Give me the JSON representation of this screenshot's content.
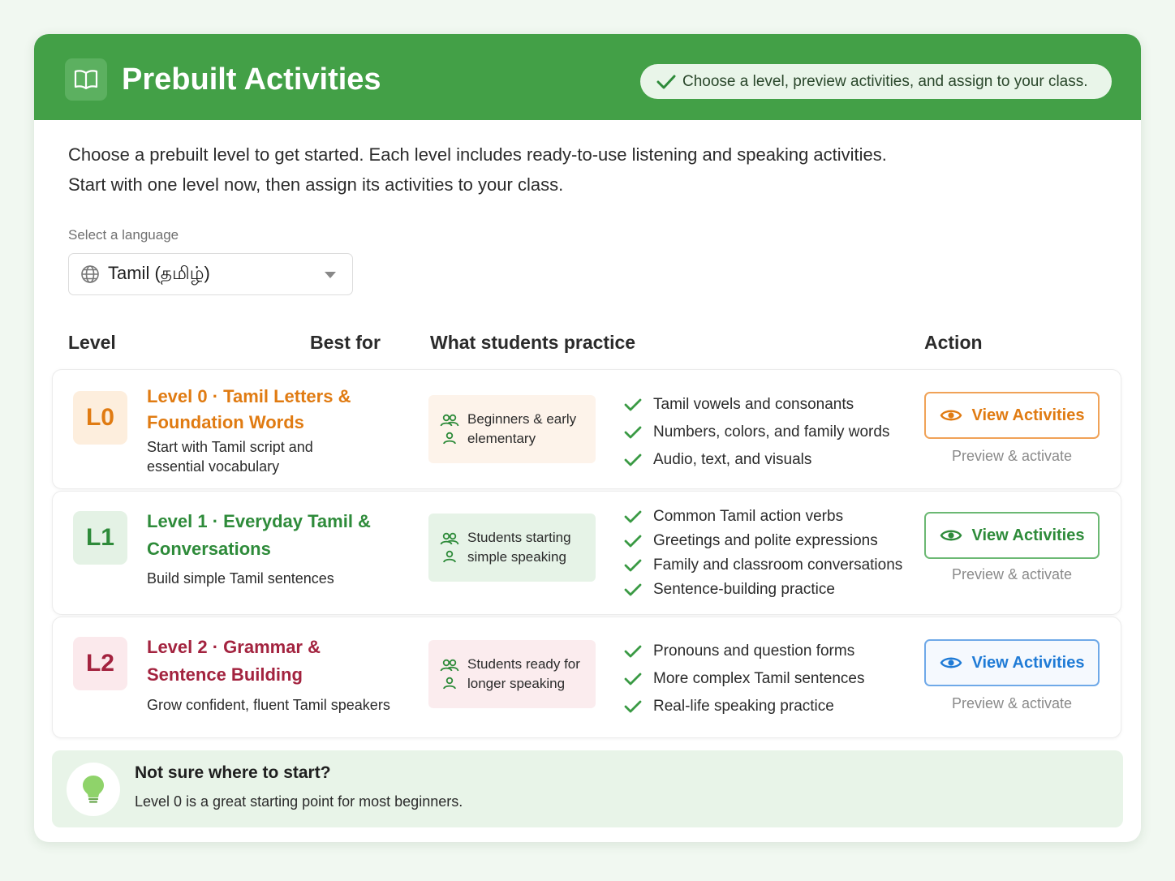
{
  "header": {
    "title": "Prebuilt Activities",
    "hint": "Choose a level, preview activities, and assign to your class."
  },
  "intro": {
    "line1": "Choose a prebuilt level to get started. Each level includes ready-to-use listening and speaking activities.",
    "line2": "Start with one level now, then assign its activities to your class."
  },
  "language": {
    "label": "Select a language",
    "selected": "Tamil (தமிழ்)"
  },
  "table": {
    "headers": {
      "level": "Level",
      "best_for": "Best for",
      "practice": "What students practice",
      "action": "Action"
    },
    "rows": [
      {
        "badge": "L0",
        "title": "Level 0 · Tamil Letters & Foundation Words",
        "desc": "Start with Tamil script and essential vocabulary",
        "best_for": "Beginners & early elementary",
        "practice": [
          "Tamil vowels and consonants",
          "Numbers, colors, and family words",
          "Audio, text, and visuals"
        ],
        "button": "View Activities",
        "subtext": "Preview & activate"
      },
      {
        "badge": "L1",
        "title": "Level 1 · Everyday Tamil & Conversations",
        "desc": "Build simple Tamil sentences",
        "best_for": "Students starting simple speaking",
        "practice": [
          "Common Tamil action verbs",
          "Greetings and polite expressions",
          "Family and classroom conversations",
          "Sentence-building practice"
        ],
        "button": "View Activities",
        "subtext": "Preview & activate"
      },
      {
        "badge": "L2",
        "title": "Level 2 · Grammar & Sentence Building",
        "desc": "Grow confident, fluent Tamil speakers",
        "best_for": "Students ready for longer speaking",
        "practice": [
          "Pronouns and question forms",
          "More complex Tamil sentences",
          "Real-life speaking practice"
        ],
        "button": "View Activities",
        "subtext": "Preview & activate"
      }
    ]
  },
  "tip": {
    "title": "Not sure where to start?",
    "text": "Level 0 is a great starting point for most beginners."
  },
  "colors": {
    "header_green": "#43a047",
    "level0": "#e07b12",
    "level1": "#2e8b3a",
    "level2": "#a3233f",
    "view_blue": "#1f7bd6",
    "check_green": "#3a9a44"
  },
  "icons": {
    "header": "open-book-icon",
    "hint": "checkmark-icon",
    "language": "globe-icon",
    "dropdown": "caret-down-icon",
    "best_for": "users-icon",
    "practice": "checkmark-icon",
    "button": "eye-icon",
    "tip": "lightbulb-icon"
  }
}
